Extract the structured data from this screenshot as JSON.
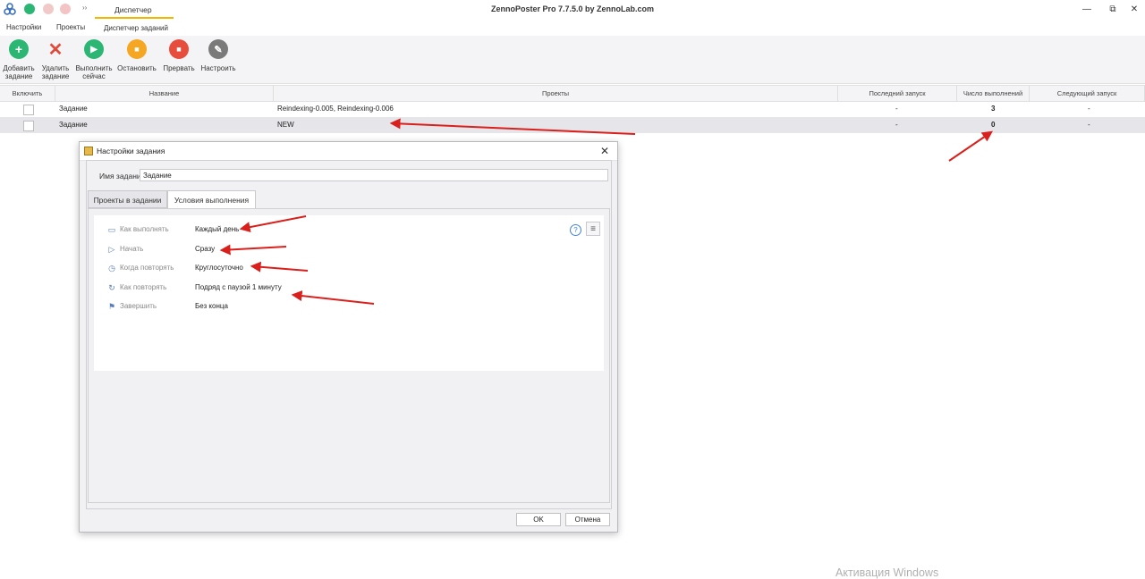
{
  "titlebar": {
    "app_title": "ZennoPoster Pro 7.7.5.0 by ZennoLab.com",
    "tab_label": "Диспетчер",
    "more_glyph": "››",
    "minimize": "—",
    "restore": "⧉",
    "close": "✕"
  },
  "menu": {
    "items": [
      "Настройки",
      "Проекты",
      "Диспетчер заданий"
    ]
  },
  "toolbar": {
    "buttons": [
      {
        "label": "Добавить\nзадание",
        "glyph": "+",
        "color": "#2bb673"
      },
      {
        "label": "Удалить\nзадание",
        "glyph": "✕",
        "color": "#e04a3a"
      },
      {
        "label": "Выполнить\nсейчас",
        "glyph": "▶",
        "color": "#2bb673"
      },
      {
        "label": "Остановить",
        "glyph": "■",
        "color": "#f5a623"
      },
      {
        "label": "Прервать",
        "glyph": "■",
        "color": "#e84c3d"
      },
      {
        "label": "Настроить",
        "glyph": "✎",
        "color": "#7a7a7a"
      }
    ]
  },
  "grid": {
    "headers": [
      "Включить",
      "Название",
      "Проекты",
      "Последний запуск",
      "Число выполнений",
      "Следующий запуск"
    ],
    "rows": [
      {
        "name": "Задание",
        "projects": "Reindexing-0.005, Reindexing-0.006",
        "last_run": "-",
        "count": "3",
        "next_run": "-"
      },
      {
        "name": "Задание",
        "projects": "NEW",
        "last_run": "-",
        "count": "0",
        "next_run": "-"
      }
    ]
  },
  "dialog": {
    "title": "Настройки задания",
    "close": "✕",
    "name_label": "Имя задания:",
    "name_value": "Задание",
    "tabs": [
      "Проекты в задании",
      "Условия выполнения"
    ],
    "conditions": [
      {
        "icon": "calendar-icon",
        "glyph": "▭",
        "label": "Как выполнять",
        "value": "Каждый день"
      },
      {
        "icon": "play-icon",
        "glyph": "▷",
        "label": "Начать",
        "value": "Сразу"
      },
      {
        "icon": "stopwatch-icon",
        "glyph": "◷",
        "label": "Когда повторять",
        "value": "Круглосуточно"
      },
      {
        "icon": "repeat-icon",
        "glyph": "↻",
        "label": "Как повторять",
        "value": "Подряд с паузой 1 минуту"
      },
      {
        "icon": "finish-flag-icon",
        "glyph": "⚑",
        "label": "Завершить",
        "value": "Без конца"
      }
    ],
    "help_glyph": "?",
    "menu_glyph": "≡",
    "ok": "OK",
    "cancel": "Отмена"
  },
  "watermark": "Активация Windows",
  "annotation_color": "#d9201c"
}
